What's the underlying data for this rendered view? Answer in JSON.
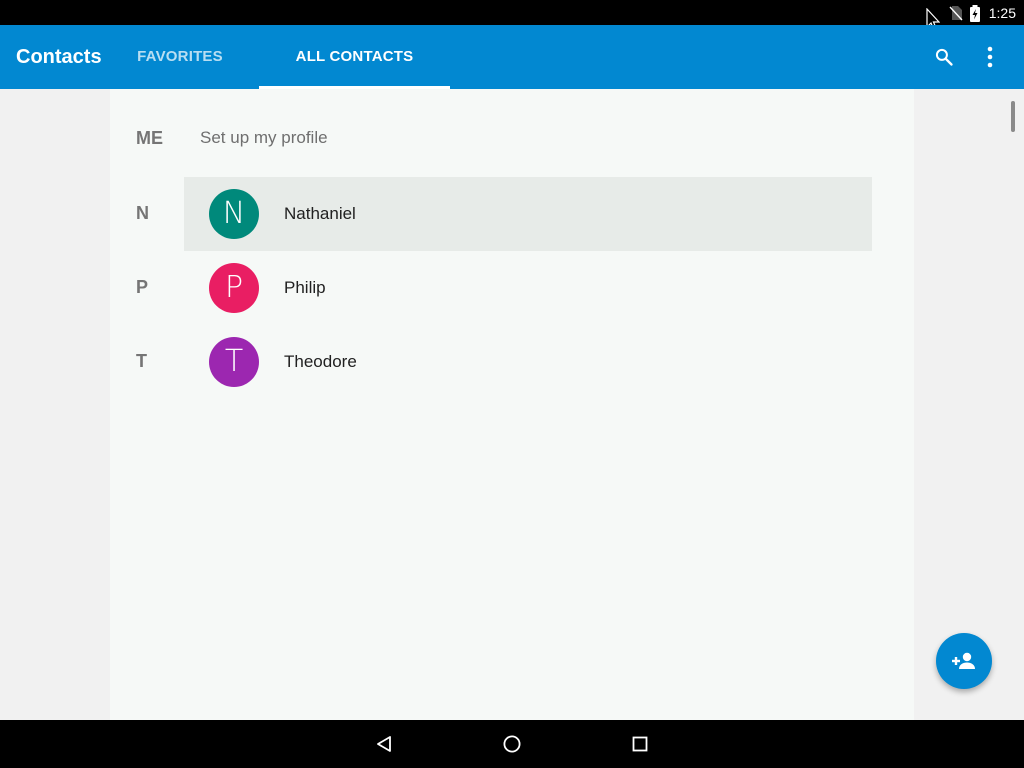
{
  "status_bar": {
    "time": "1:25",
    "icons": [
      "no-sim-icon",
      "battery-charging-icon"
    ]
  },
  "app_bar": {
    "title": "Contacts",
    "tabs": [
      {
        "label": "FAVORITES",
        "selected": false
      },
      {
        "label": "ALL CONTACTS",
        "selected": true
      }
    ],
    "actions": [
      "search-icon",
      "more-vert-icon"
    ],
    "color": "#0288d1"
  },
  "profile": {
    "label": "ME",
    "text": "Set up my profile"
  },
  "contacts": [
    {
      "section": "N",
      "initial": "N",
      "name": "Nathaniel",
      "color": "#00897b",
      "highlighted": true
    },
    {
      "section": "P",
      "initial": "P",
      "name": "Philip",
      "color": "#e91e63",
      "highlighted": false
    },
    {
      "section": "T",
      "initial": "T",
      "name": "Theodore",
      "color": "#9c27b0",
      "highlighted": false
    }
  ],
  "fab": {
    "icon": "add-person-icon"
  },
  "nav_bar": {
    "buttons": [
      "back-icon",
      "home-icon",
      "recents-icon"
    ]
  }
}
